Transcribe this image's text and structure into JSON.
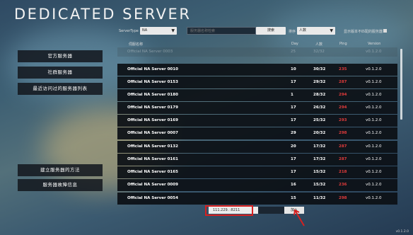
{
  "app": {
    "title": "DEDICATED SERVER",
    "version_label": "v0.1.2.0"
  },
  "filters": {
    "server_type_label": "ServerType",
    "server_type_value": "NA",
    "search_placeholder": "服务器名称检索",
    "search_button": "搜索",
    "sort_label": "排序",
    "sort_value": "人数",
    "checkbox_label": "显示版本不匹配的服务器"
  },
  "sidebar": {
    "items": [
      {
        "label": "官方服务器"
      },
      {
        "label": "社群服务器"
      },
      {
        "label": "最近访问过的服务器列表"
      }
    ],
    "bottom_items": [
      {
        "label": "建立服务器的方法"
      },
      {
        "label": "服务器故障信息"
      }
    ]
  },
  "table": {
    "columns": {
      "name": "伺服名称",
      "day": "Day",
      "players": "人数",
      "ping": "Ping",
      "version": "Version"
    },
    "rows": [
      {
        "name": "Official NA Server 0003",
        "day": "25",
        "players": "32/32",
        "ping": "",
        "version": "v0.1.2.0"
      },
      {
        "name": "Official NA Server 0010",
        "day": "10",
        "players": "30/32",
        "ping": "235",
        "version": "v0.1.2.0"
      },
      {
        "name": "Official NA Server 0153",
        "day": "17",
        "players": "29/32",
        "ping": "287",
        "version": "v0.1.2.0"
      },
      {
        "name": "Official NA Server 0180",
        "day": "1",
        "players": "28/32",
        "ping": "294",
        "version": "v0.1.2.0"
      },
      {
        "name": "Official NA Server 0179",
        "day": "17",
        "players": "26/32",
        "ping": "294",
        "version": "v0.1.2.0"
      },
      {
        "name": "Official NA Server 0169",
        "day": "17",
        "players": "25/32",
        "ping": "293",
        "version": "v0.1.2.0"
      },
      {
        "name": "Official NA Server 0007",
        "day": "29",
        "players": "20/32",
        "ping": "298",
        "version": "v0.1.2.0"
      },
      {
        "name": "Official NA Server 0132",
        "day": "20",
        "players": "17/32",
        "ping": "287",
        "version": "v0.1.2.0"
      },
      {
        "name": "Official NA Server 0161",
        "day": "17",
        "players": "17/32",
        "ping": "287",
        "version": "v0.1.2.0"
      },
      {
        "name": "Official NA Server 0165",
        "day": "17",
        "players": "15/32",
        "ping": "218",
        "version": "v0.1.2.0"
      },
      {
        "name": "Official NA Server 0009",
        "day": "16",
        "players": "15/32",
        "ping": "236",
        "version": "v0.1.2.0"
      },
      {
        "name": "Official NA Server 0054",
        "day": "15",
        "players": "11/32",
        "ping": "298",
        "version": "v0.1.2.0"
      }
    ]
  },
  "connect": {
    "ip_value": "111.229.       :8211",
    "join_button": "加入"
  },
  "colors": {
    "ping": "#e23b3b",
    "highlight": "#d62020"
  }
}
